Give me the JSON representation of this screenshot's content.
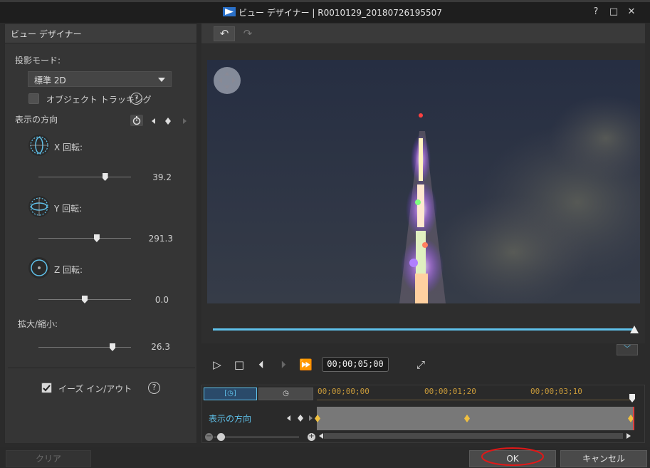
{
  "window": {
    "title": "ビュー デザイナー  |  R0010129_20180726195507",
    "help": "?",
    "maximize": "□",
    "close": "✕"
  },
  "left_panel": {
    "header": "ビュー デザイナー",
    "projection_mode_label": "投影モード:",
    "projection_mode_value": "標準 2D",
    "object_tracking_label": "オブジェクト トラッキング",
    "direction_label": "表示の方向",
    "x_rotation": {
      "label": "X 回転:",
      "value": "39.2",
      "level": 0.72
    },
    "y_rotation": {
      "label": "Y 回転:",
      "value": "291.3",
      "level": 0.63
    },
    "z_rotation": {
      "label": "Z 回転:",
      "value": "0.0",
      "level": 0.5
    },
    "zoom": {
      "label": "拡大/縮小:",
      "value": "26.3",
      "level": 0.8
    },
    "ease_label": "イーズ イン/アウト",
    "ease_checked": true,
    "help": "?"
  },
  "player": {
    "timecode": "00;00;05;00",
    "progress": 1.0
  },
  "timeline": {
    "ruler": [
      "00;00;00;00",
      "00;00;01;20",
      "00;00;03;10"
    ],
    "track_label": "表示の方向"
  },
  "buttons": {
    "clear": "クリア",
    "ok": "OK",
    "cancel": "キャンセル"
  },
  "colors": {
    "accent": "#5fc1ea",
    "keyframe": "#f0c040",
    "ok_highlight": "#e01818"
  }
}
